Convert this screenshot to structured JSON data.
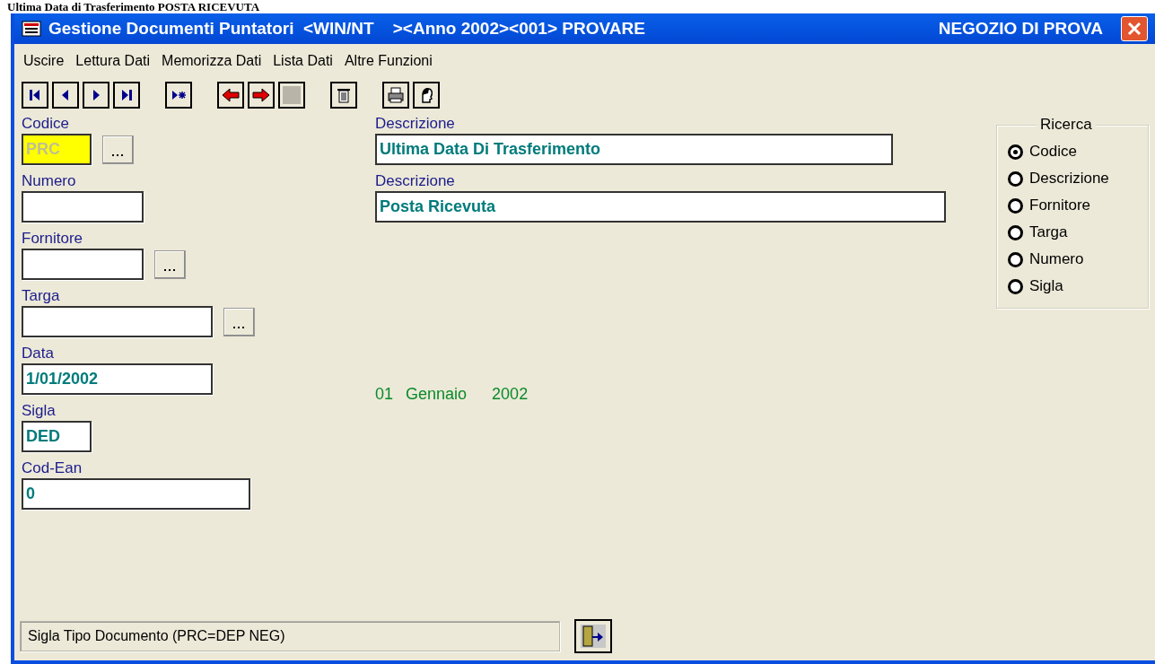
{
  "page_heading": "Ultima Data di Trasferimento POSTA RICEVUTA",
  "window": {
    "title": "Gestione Documenti Puntatori  <WIN/NT    ><Anno 2002><001> PROVARE",
    "company": "NEGOZIO DI PROVA"
  },
  "menu": [
    "Uscire",
    "Lettura Dati",
    "Memorizza Dati",
    "Lista Dati",
    "Altre Funzioni"
  ],
  "toolbar_groups": [
    {
      "buttons": [
        {
          "kind": "first"
        },
        {
          "kind": "prev"
        },
        {
          "kind": "next"
        },
        {
          "kind": "last"
        }
      ]
    },
    {
      "buttons": [
        {
          "kind": "new"
        }
      ]
    },
    {
      "buttons": [
        {
          "kind": "back"
        },
        {
          "kind": "forward"
        },
        {
          "kind": "blank"
        }
      ]
    },
    {
      "buttons": [
        {
          "kind": "delete"
        }
      ]
    },
    {
      "buttons": [
        {
          "kind": "print"
        },
        {
          "kind": "face"
        }
      ]
    }
  ],
  "fields": [
    {
      "label": "Codice",
      "value": "PRC",
      "highlighted": true,
      "browse": true
    },
    {
      "label": "Numero",
      "highlighted": false,
      "browse": false
    },
    {
      "label": "Fornitore",
      "highlighted": false,
      "browse": true
    },
    {
      "label": "Targa",
      "highlighted": false,
      "browse": true
    },
    {
      "label": "Data",
      "value": "1/01/2002",
      "highlighted": false,
      "browse": false
    },
    {
      "label": "Sigla",
      "value": "DED",
      "highlighted": false,
      "browse": false
    },
    {
      "label": "Cod-Ean",
      "value": "0",
      "highlighted": false,
      "browse": false
    }
  ],
  "descriptions": [
    {
      "label": "Descrizione",
      "value": "Ultima Data Di Trasferimento"
    },
    {
      "label": "Descrizione",
      "value": "Posta Ricevuta"
    }
  ],
  "date_text": {
    "day": "01",
    "month": "Gennaio",
    "year": "2002"
  },
  "search": {
    "title": "Ricerca",
    "options": [
      {
        "label": "Codice",
        "selected": true
      },
      {
        "label": "Descrizione",
        "selected": false
      },
      {
        "label": "Fornitore",
        "selected": false
      },
      {
        "label": "Targa",
        "selected": false
      },
      {
        "label": "Numero",
        "selected": false
      },
      {
        "label": "Sigla",
        "selected": false
      }
    ]
  },
  "status_bar": "Sigla Tipo Documento (PRC=DEP NEG)"
}
